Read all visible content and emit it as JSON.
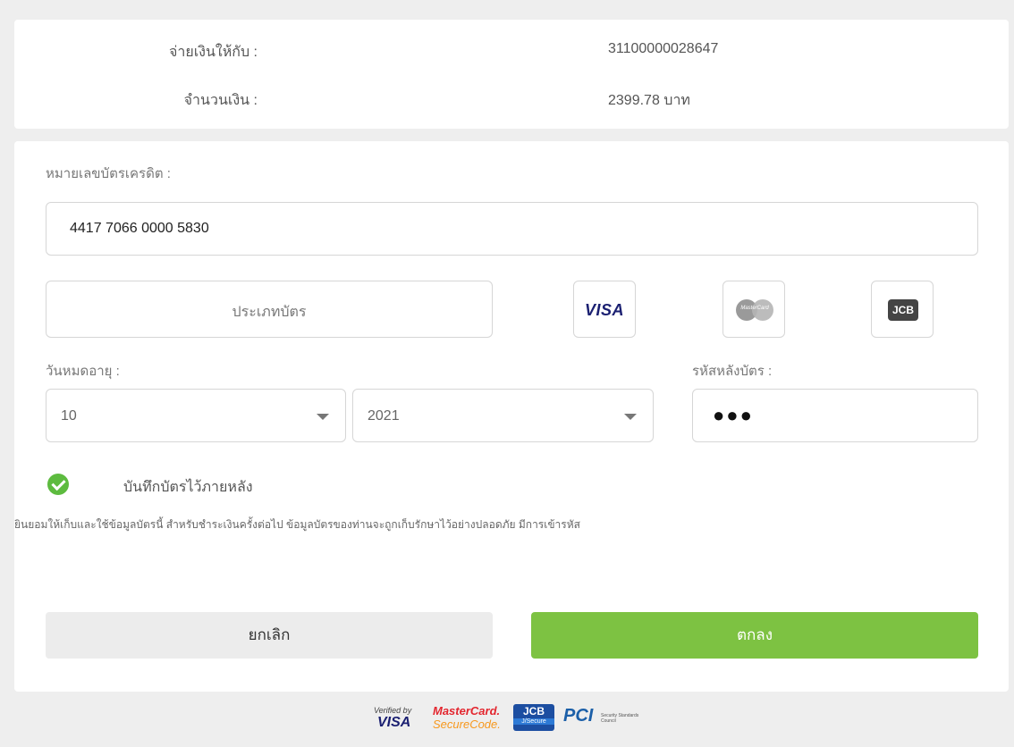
{
  "summary": {
    "pay_to_label": "จ่ายเงินให้กับ :",
    "pay_to_value": "31100000028647",
    "amount_label": "จำนวนเงิน :",
    "amount_value": "2399.78 บาท"
  },
  "form": {
    "card_number_label": "หมายเลขบัตรเครดิต :",
    "card_number_value": "4417 7066 0000 5830",
    "card_type_placeholder": "ประเภทบัตร",
    "brands": {
      "visa": "VISA",
      "mastercard": "MasterCard",
      "jcb": "JCB"
    },
    "expiry_label": "วันหมดอายุ :",
    "expiry_month": "10",
    "expiry_year": "2021",
    "cvv_label": "รหัสหลังบัตร :",
    "cvv_value": "●●●",
    "save_card_checked": true,
    "save_card_label": "บันทึกบัตรไว้ภายหลัง",
    "consent_text": "ยินยอมให้เก็บและใช้ข้อมูลบัตรนี้ สำหรับชำระเงินครั้งต่อไป ข้อมูลบัตรของท่านจะถูกเก็บรักษาไว้อย่างปลอดภัย มีการเข้ารหัส"
  },
  "buttons": {
    "cancel": "ยกเลิก",
    "ok": "ตกลง"
  },
  "footer_logos": {
    "vbv_small": "Verified by",
    "vbv_big": "VISA",
    "mc_line1": "MasterCard.",
    "mc_line2": "SecureCode.",
    "jcb_top": "JCB",
    "jcb_bottom": "J/Secure",
    "pci": "PCI",
    "pci_small": "Security Standards Council"
  },
  "colors": {
    "accent_green": "#7dc242",
    "check_green": "#5dbb3f",
    "background": "#eeeeee"
  }
}
